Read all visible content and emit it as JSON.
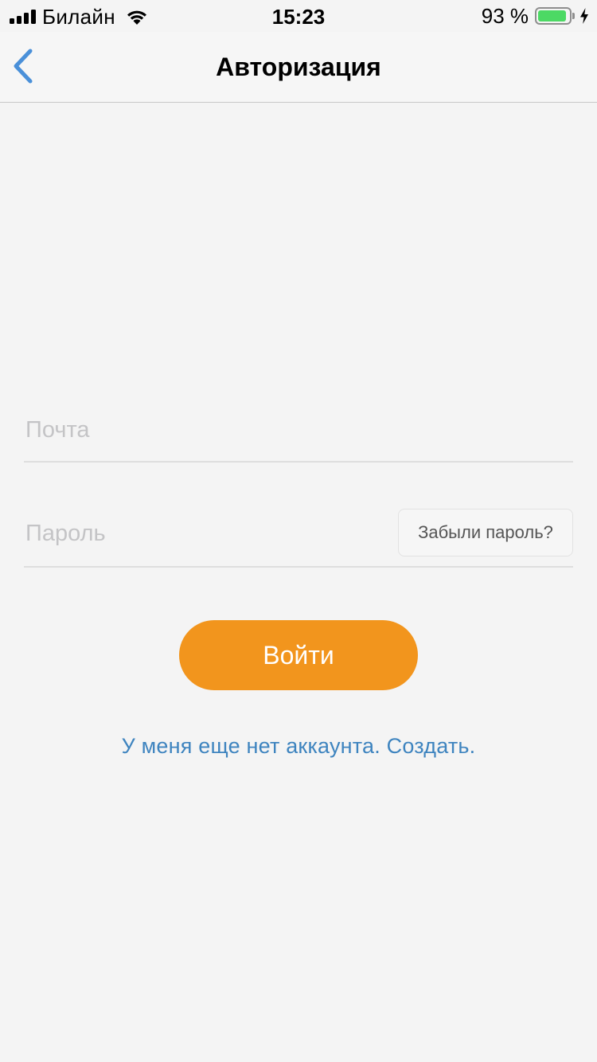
{
  "status_bar": {
    "carrier": "Билайн",
    "time": "15:23",
    "battery_percent": "93 %",
    "battery_level": 0.93,
    "icons": [
      "signal-icon",
      "wifi-icon",
      "battery-icon",
      "charging-bolt-icon"
    ]
  },
  "nav": {
    "title": "Авторизация",
    "back_icon": "chevron-left-icon"
  },
  "form": {
    "email_placeholder": "Почта",
    "email_value": "",
    "password_placeholder": "Пароль",
    "password_value": "",
    "forgot_label": "Забыли пароль?",
    "login_label": "Войти",
    "signup_label": "У меня еще нет аккаунта. Создать."
  },
  "colors": {
    "accent_orange": "#f2951d",
    "link_blue": "#3e84bf",
    "back_blue": "#4a90d9",
    "battery_green": "#4cd964"
  }
}
